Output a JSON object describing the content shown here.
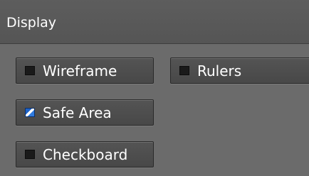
{
  "panel": {
    "title": "Display"
  },
  "toggles": [
    {
      "label": "Wireframe",
      "checked": false
    },
    {
      "label": "Rulers",
      "checked": false
    },
    {
      "label": "Safe Area",
      "checked": true
    },
    {
      "label": "Checkboard",
      "checked": false
    }
  ],
  "colors": {
    "background": "#6b6b6b",
    "header": "#575757",
    "button": "#4e4e4e",
    "checked_accent": "#1e63c8",
    "text": "#ffffff"
  }
}
